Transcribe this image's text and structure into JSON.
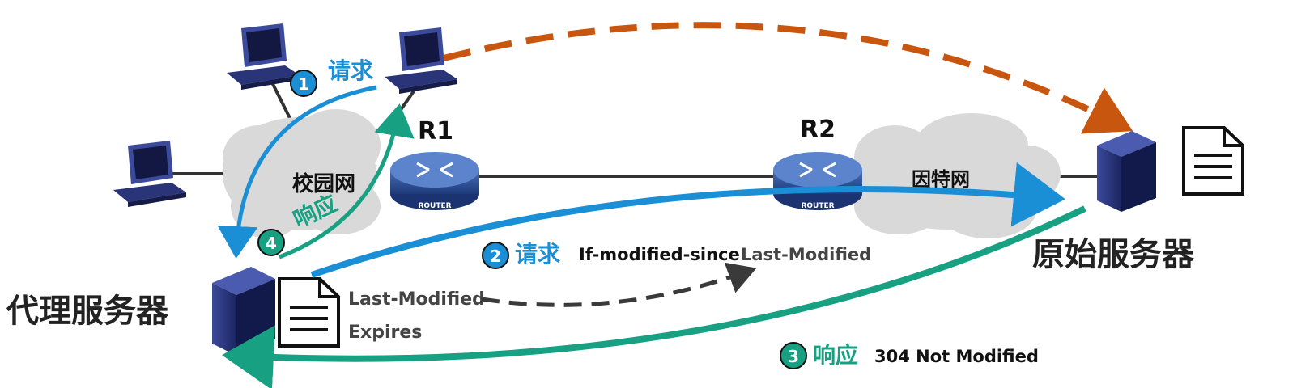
{
  "labels": {
    "campus_net": "校园网",
    "internet": "因特网",
    "proxy_server": "代理服务器",
    "origin_server": "原始服务器",
    "router1": "R1",
    "router2": "R2",
    "router_caption": "ROUTER"
  },
  "steps": [
    {
      "num": "1",
      "action": "请求",
      "detail": ""
    },
    {
      "num": "2",
      "action": "请求",
      "detail": "If-modified-since",
      "detail2": "Last-Modified"
    },
    {
      "num": "3",
      "action": "响应",
      "detail": "304 Not Modified"
    },
    {
      "num": "4",
      "action": "响应",
      "detail": ""
    }
  ],
  "cache_doc": {
    "line1": "Last-Modified",
    "line2": "Expires"
  },
  "colors": {
    "blue": "#1a8fd6",
    "green": "#17a082",
    "orange": "#c9560f",
    "dark_dash": "#3a3a3a",
    "cloud": "#d9d9d9",
    "device": "#27306a"
  }
}
